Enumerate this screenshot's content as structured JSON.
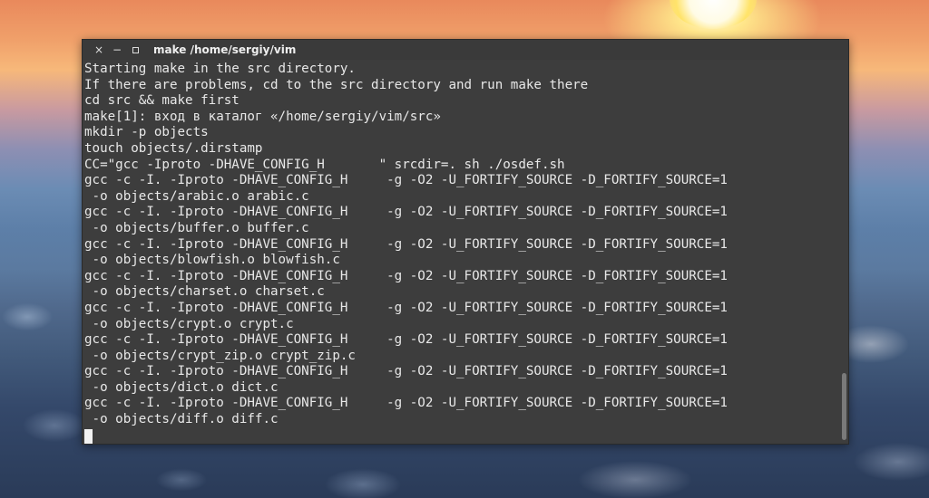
{
  "window": {
    "title": "make  /home/sergiy/vim",
    "close_glyph": "×",
    "minimize_glyph": "−"
  },
  "terminal": {
    "lines": [
      "Starting make in the src directory.",
      "If there are problems, cd to the src directory and run make there",
      "cd src && make first",
      "make[1]: вход в каталог «/home/sergiy/vim/src»",
      "mkdir -p objects",
      "touch objects/.dirstamp",
      "CC=\"gcc -Iproto -DHAVE_CONFIG_H       \" srcdir=. sh ./osdef.sh",
      "gcc -c -I. -Iproto -DHAVE_CONFIG_H     -g -O2 -U_FORTIFY_SOURCE -D_FORTIFY_SOURCE=1",
      " -o objects/arabic.o arabic.c",
      "gcc -c -I. -Iproto -DHAVE_CONFIG_H     -g -O2 -U_FORTIFY_SOURCE -D_FORTIFY_SOURCE=1",
      " -o objects/buffer.o buffer.c",
      "gcc -c -I. -Iproto -DHAVE_CONFIG_H     -g -O2 -U_FORTIFY_SOURCE -D_FORTIFY_SOURCE=1",
      " -o objects/blowfish.o blowfish.c",
      "gcc -c -I. -Iproto -DHAVE_CONFIG_H     -g -O2 -U_FORTIFY_SOURCE -D_FORTIFY_SOURCE=1",
      " -o objects/charset.o charset.c",
      "gcc -c -I. -Iproto -DHAVE_CONFIG_H     -g -O2 -U_FORTIFY_SOURCE -D_FORTIFY_SOURCE=1",
      " -o objects/crypt.o crypt.c",
      "gcc -c -I. -Iproto -DHAVE_CONFIG_H     -g -O2 -U_FORTIFY_SOURCE -D_FORTIFY_SOURCE=1",
      " -o objects/crypt_zip.o crypt_zip.c",
      "gcc -c -I. -Iproto -DHAVE_CONFIG_H     -g -O2 -U_FORTIFY_SOURCE -D_FORTIFY_SOURCE=1",
      " -o objects/dict.o dict.c",
      "gcc -c -I. -Iproto -DHAVE_CONFIG_H     -g -O2 -U_FORTIFY_SOURCE -D_FORTIFY_SOURCE=1",
      " -o objects/diff.o diff.c"
    ]
  },
  "colors": {
    "terminal_bg": "#3d3d3d",
    "terminal_fg": "#e8e8e8",
    "titlebar_bg": "#3a3a3a"
  }
}
